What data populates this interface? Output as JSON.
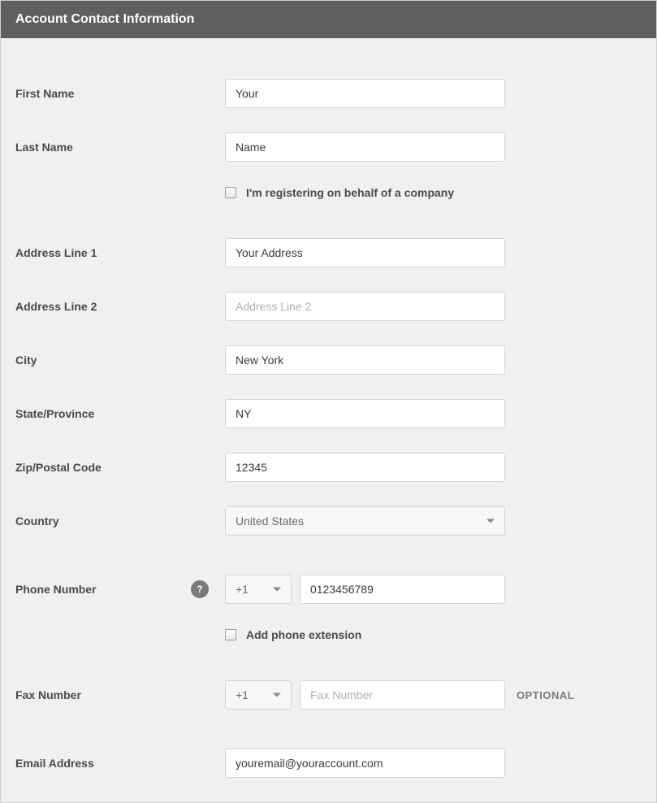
{
  "header": {
    "title": "Account Contact Information"
  },
  "form": {
    "firstName": {
      "label": "First Name",
      "value": "Your"
    },
    "lastName": {
      "label": "Last Name",
      "value": "Name"
    },
    "companyCheck": {
      "label": "I'm registering on behalf of a company",
      "checked": false
    },
    "address1": {
      "label": "Address Line 1",
      "value": "Your Address"
    },
    "address2": {
      "label": "Address Line 2",
      "value": "",
      "placeholder": "Address Line 2"
    },
    "city": {
      "label": "City",
      "value": "New York"
    },
    "state": {
      "label": "State/Province",
      "value": "NY"
    },
    "zip": {
      "label": "Zip/Postal Code",
      "value": "12345"
    },
    "country": {
      "label": "Country",
      "value": "United States"
    },
    "phone": {
      "label": "Phone Number",
      "dialCode": "+1",
      "value": "0123456789",
      "helpIcon": "?"
    },
    "phoneExt": {
      "label": "Add phone extension",
      "checked": false
    },
    "fax": {
      "label": "Fax Number",
      "dialCode": "+1",
      "value": "",
      "placeholder": "Fax Number",
      "badge": "OPTIONAL"
    },
    "email": {
      "label": "Email Address",
      "value": "youremail@youraccount.com"
    }
  }
}
